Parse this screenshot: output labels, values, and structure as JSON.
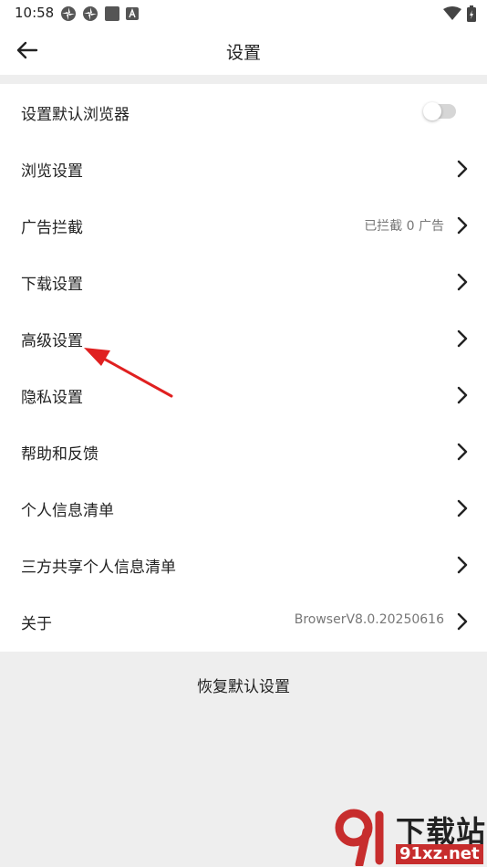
{
  "status_bar": {
    "time": "10:58",
    "left_icons": [
      "pinwheel-icon",
      "pinwheel-icon",
      "square-icon",
      "a-icon"
    ],
    "right_icons": [
      "wifi-icon",
      "battery-charging-icon"
    ]
  },
  "header": {
    "back_icon": "arrow-left-icon",
    "title": "设置"
  },
  "settings": {
    "default_browser": {
      "label": "设置默认浏览器",
      "toggle_on": false
    },
    "browsing": {
      "label": "浏览设置"
    },
    "ad_block": {
      "label": "广告拦截",
      "value": "已拦截 0 广告"
    },
    "download": {
      "label": "下载设置"
    },
    "advanced": {
      "label": "高级设置"
    },
    "privacy": {
      "label": "隐私设置"
    },
    "help": {
      "label": "帮助和反馈"
    },
    "personal_info": {
      "label": "个人信息清单"
    },
    "third_party_info": {
      "label": "三方共享个人信息清单"
    },
    "about": {
      "label": "关于",
      "value": "BrowserV8.0.20250616"
    }
  },
  "footer": {
    "reset_label": "恢复默认设置"
  },
  "annotation": {
    "arrow_color": "#e02020",
    "points_to": "高级设置"
  },
  "watermark": {
    "text": "下载站",
    "url": "91xz.net",
    "logo_color": "#c72d2d"
  }
}
